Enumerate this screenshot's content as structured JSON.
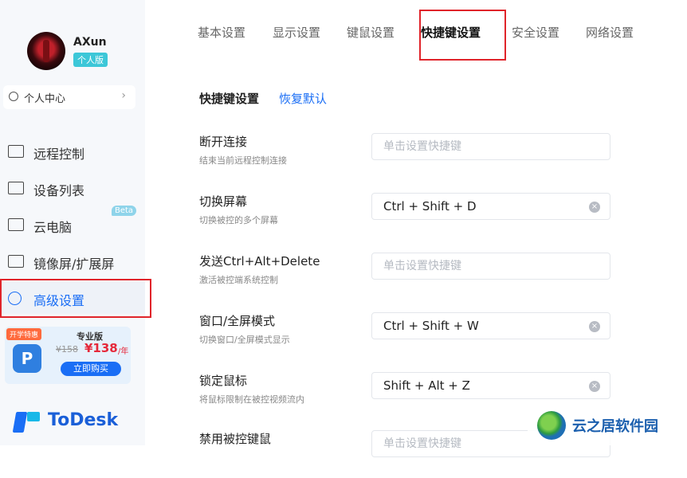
{
  "sidebar": {
    "user": {
      "name": "AXun",
      "edition": "个人版"
    },
    "personal_center": {
      "label": "个人中心",
      "chevron": "›"
    },
    "nav": [
      {
        "label": "远程控制",
        "icon": "remote-control-icon"
      },
      {
        "label": "设备列表",
        "icon": "device-list-icon"
      },
      {
        "label": "云电脑",
        "icon": "cloud-pc-icon",
        "badge": "Beta"
      },
      {
        "label": "镜像屏/扩展屏",
        "icon": "mirror-screen-icon"
      },
      {
        "label": "高级设置",
        "icon": "advanced-settings-icon",
        "active": true
      }
    ],
    "promo": {
      "tag": "开学特惠",
      "title": "专业版",
      "logo_letter": "P",
      "old_price": "¥158",
      "new_price": "¥138",
      "unit": "/年",
      "buy_label": "立即购买"
    },
    "brand": {
      "name": "ToDesk"
    }
  },
  "tabs": [
    "基本设置",
    "显示设置",
    "键鼠设置",
    "快捷键设置",
    "安全设置",
    "网络设置"
  ],
  "active_tab": "快捷键设置",
  "section": {
    "title": "快捷键设置",
    "restore_label": "恢复默认"
  },
  "shortcuts": [
    {
      "title": "断开连接",
      "desc": "结束当前远程控制连接",
      "value": "",
      "placeholder": "单击设置快捷键"
    },
    {
      "title": "切换屏幕",
      "desc": "切换被控的多个屏幕",
      "value": "Ctrl + Shift + D",
      "placeholder": ""
    },
    {
      "title": "发送Ctrl+Alt+Delete",
      "desc": "激活被控端系统控制",
      "value": "",
      "placeholder": "单击设置快捷键"
    },
    {
      "title": "窗口/全屏模式",
      "desc": "切换窗口/全屏模式显示",
      "value": "Ctrl + Shift + W",
      "placeholder": ""
    },
    {
      "title": "锁定鼠标",
      "desc": "将鼠标限制在被控视频流内",
      "value": "Shift + Alt + Z",
      "placeholder": ""
    },
    {
      "title": "禁用被控键鼠",
      "desc": "",
      "value": "",
      "placeholder": "单击设置快捷键"
    }
  ],
  "watermark": {
    "text": "云之居软件园"
  },
  "colors": {
    "accent": "#1a6ef5",
    "highlight_box": "#e0242a",
    "promo_price": "#e5283a"
  }
}
